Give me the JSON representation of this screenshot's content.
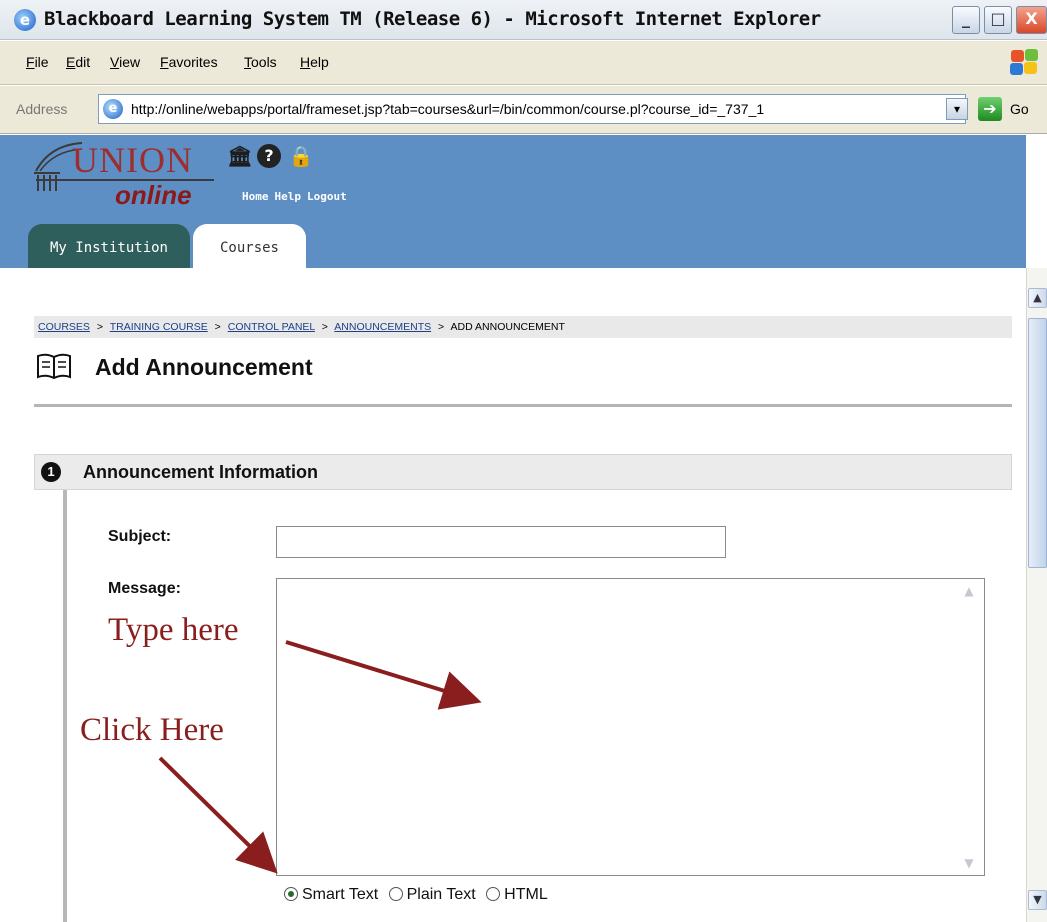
{
  "window": {
    "title": "Blackboard Learning System TM (Release 6) - Microsoft Internet Explorer",
    "controls": [
      "_",
      "□",
      "X"
    ]
  },
  "menu": [
    "File",
    "Edit",
    "View",
    "Favorites",
    "Tools",
    "Help"
  ],
  "address": {
    "label": "Address",
    "url": "http://online/webapps/portal/frameset.jsp?tab=courses&url=/bin/common/course.pl?course_id=_737_1",
    "go_label": "Go"
  },
  "logo": {
    "top": "UNION",
    "bottom": "online"
  },
  "nav": {
    "home": "Home",
    "help": "Help",
    "logout": "Logout"
  },
  "tabs": {
    "my_institution": "My Institution",
    "courses": "Courses"
  },
  "breadcrumb": {
    "items": [
      "COURSES",
      "TRAINING COURSE",
      "CONTROL PANEL",
      "ANNOUNCEMENTS"
    ],
    "current": "ADD ANNOUNCEMENT",
    "separator": ">"
  },
  "page": {
    "title": "Add Announcement"
  },
  "section": {
    "number": "1",
    "title": "Announcement Information"
  },
  "form": {
    "subject_label": "Subject:",
    "subject_value": "",
    "message_label": "Message:",
    "message_value": "",
    "text_format": {
      "options": [
        "Smart Text",
        "Plain Text",
        "HTML"
      ],
      "selected": "Smart Text"
    }
  },
  "annotations": {
    "type_here": "Type here",
    "click_here": "Click Here",
    "color": "#8a1e1e"
  },
  "colors": {
    "header_bg": "#5d8fc4",
    "tab_my_institution": "#2f5f5c",
    "link": "#1e3f8a"
  }
}
